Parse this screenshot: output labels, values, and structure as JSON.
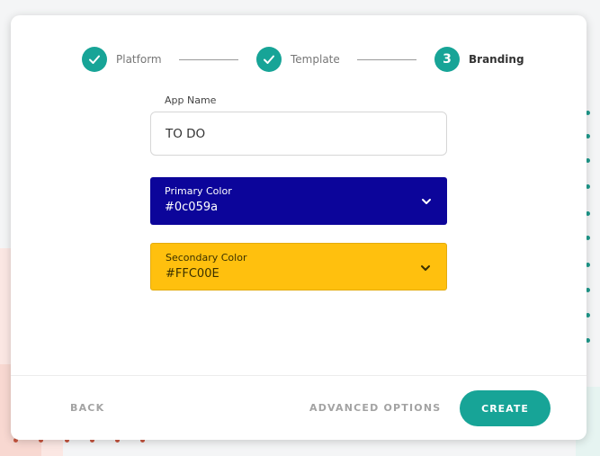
{
  "stepper": {
    "steps": [
      {
        "label": "Platform",
        "state": "done",
        "icon": "check-icon"
      },
      {
        "label": "Template",
        "state": "done",
        "icon": "check-icon"
      },
      {
        "label": "Branding",
        "state": "active",
        "number": "3"
      }
    ]
  },
  "form": {
    "app_name": {
      "label": "App Name",
      "value": "TO DO"
    },
    "primary_color": {
      "label": "Primary Color",
      "value": "#0c059a"
    },
    "secondary_color": {
      "label": "Secondary Color",
      "value": "#FFC00E"
    }
  },
  "footer": {
    "back_label": "BACK",
    "advanced_label": "ADVANCED OPTIONS",
    "create_label": "CREATE"
  },
  "colors": {
    "accent": "#17a497",
    "primary_swatch": "#0c059a",
    "secondary_swatch": "#FFC00E"
  }
}
